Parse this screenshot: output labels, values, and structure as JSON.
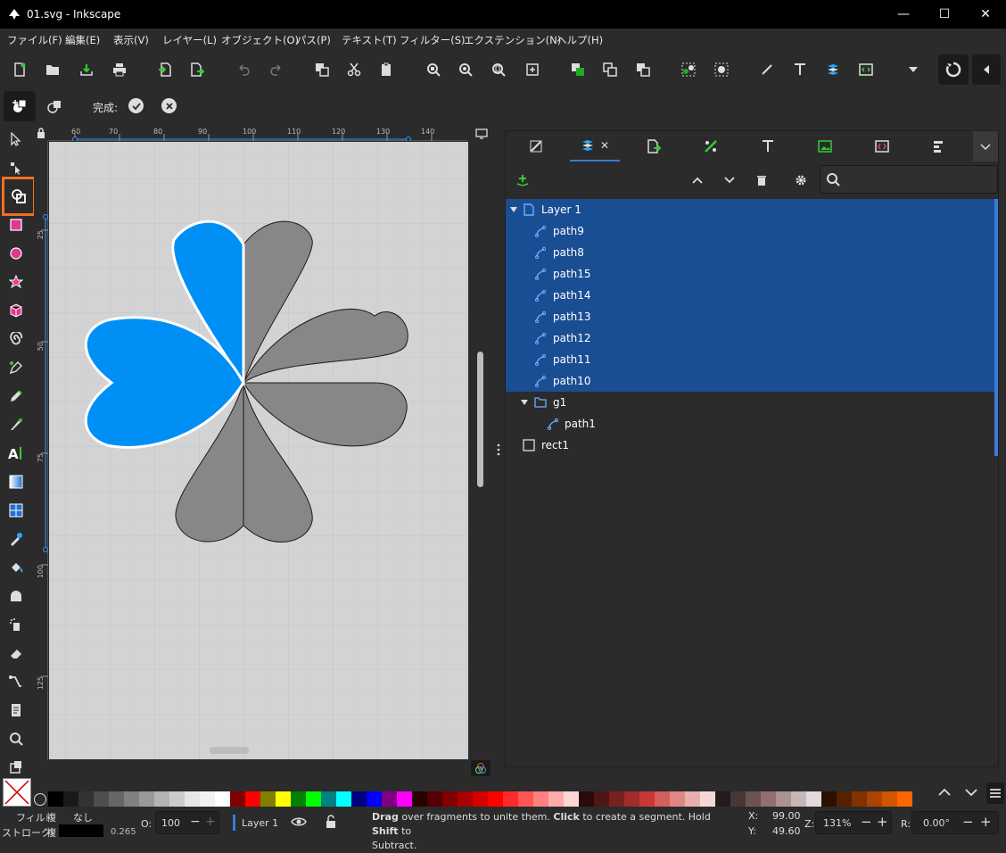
{
  "window": {
    "title": "01.svg - Inkscape",
    "minimize": "—",
    "maximize": "☐",
    "close": "✕"
  },
  "menu": [
    "ファイル(F)",
    "編集(E)",
    "表示(V)",
    "レイヤー(L)",
    "オブジェクト(O)",
    "パス(P)",
    "テキスト(T)",
    "フィルター(S)",
    "エクステンション(N)",
    "ヘルプ(H)"
  ],
  "tooloptions": {
    "done_label": "完成:"
  },
  "ruler": {
    "top_ticks": [
      "60",
      "70",
      "80",
      "90",
      "100",
      "110",
      "120",
      "130",
      "140"
    ],
    "left_ticks": [
      "25",
      "50",
      "75",
      "100",
      "125"
    ]
  },
  "layers": {
    "rows": [
      {
        "name": "Layer 1",
        "type": "layer",
        "selected": true
      },
      {
        "name": "path9",
        "type": "path",
        "selected": true
      },
      {
        "name": "path8",
        "type": "path",
        "selected": true
      },
      {
        "name": "path15",
        "type": "path",
        "selected": true
      },
      {
        "name": "path14",
        "type": "path",
        "selected": true
      },
      {
        "name": "path13",
        "type": "path",
        "selected": true
      },
      {
        "name": "path12",
        "type": "path",
        "selected": true
      },
      {
        "name": "path11",
        "type": "path",
        "selected": true
      },
      {
        "name": "path10",
        "type": "path",
        "selected": true
      },
      {
        "name": "g1",
        "type": "group",
        "selected": false
      },
      {
        "name": "path1",
        "type": "path",
        "selected": false
      },
      {
        "name": "rect1",
        "type": "rect",
        "selected": false
      }
    ]
  },
  "status": {
    "fill_label": "フィル:",
    "fill_value": "複",
    "fill_none": "なし",
    "stroke_label": "ストローク:",
    "stroke_value": "複",
    "stroke_width": "0.265",
    "opacity_label": "O:",
    "opacity_value": "100",
    "layer_name": "Layer 1",
    "message_bold1": "Drag",
    "message_1": " over fragments to unite them. ",
    "message_bold2": "Click",
    "message_2": " to create a segment. Hold ",
    "message_bold3": "Shift",
    "message_3": " to",
    "message_line2": "Subtract.",
    "x_label": "X:",
    "x_value": "99.00",
    "y_label": "Y:",
    "y_value": "49.60",
    "zoom_label": "Z:",
    "zoom_value": "131%",
    "rotate_label": "R:",
    "rotate_value": "0.00°"
  },
  "colors": {
    "accent": "#1a4e93",
    "highlight_tool": "#f07020",
    "fill_blue": "#0090f5",
    "petal_gray": "#878787"
  }
}
